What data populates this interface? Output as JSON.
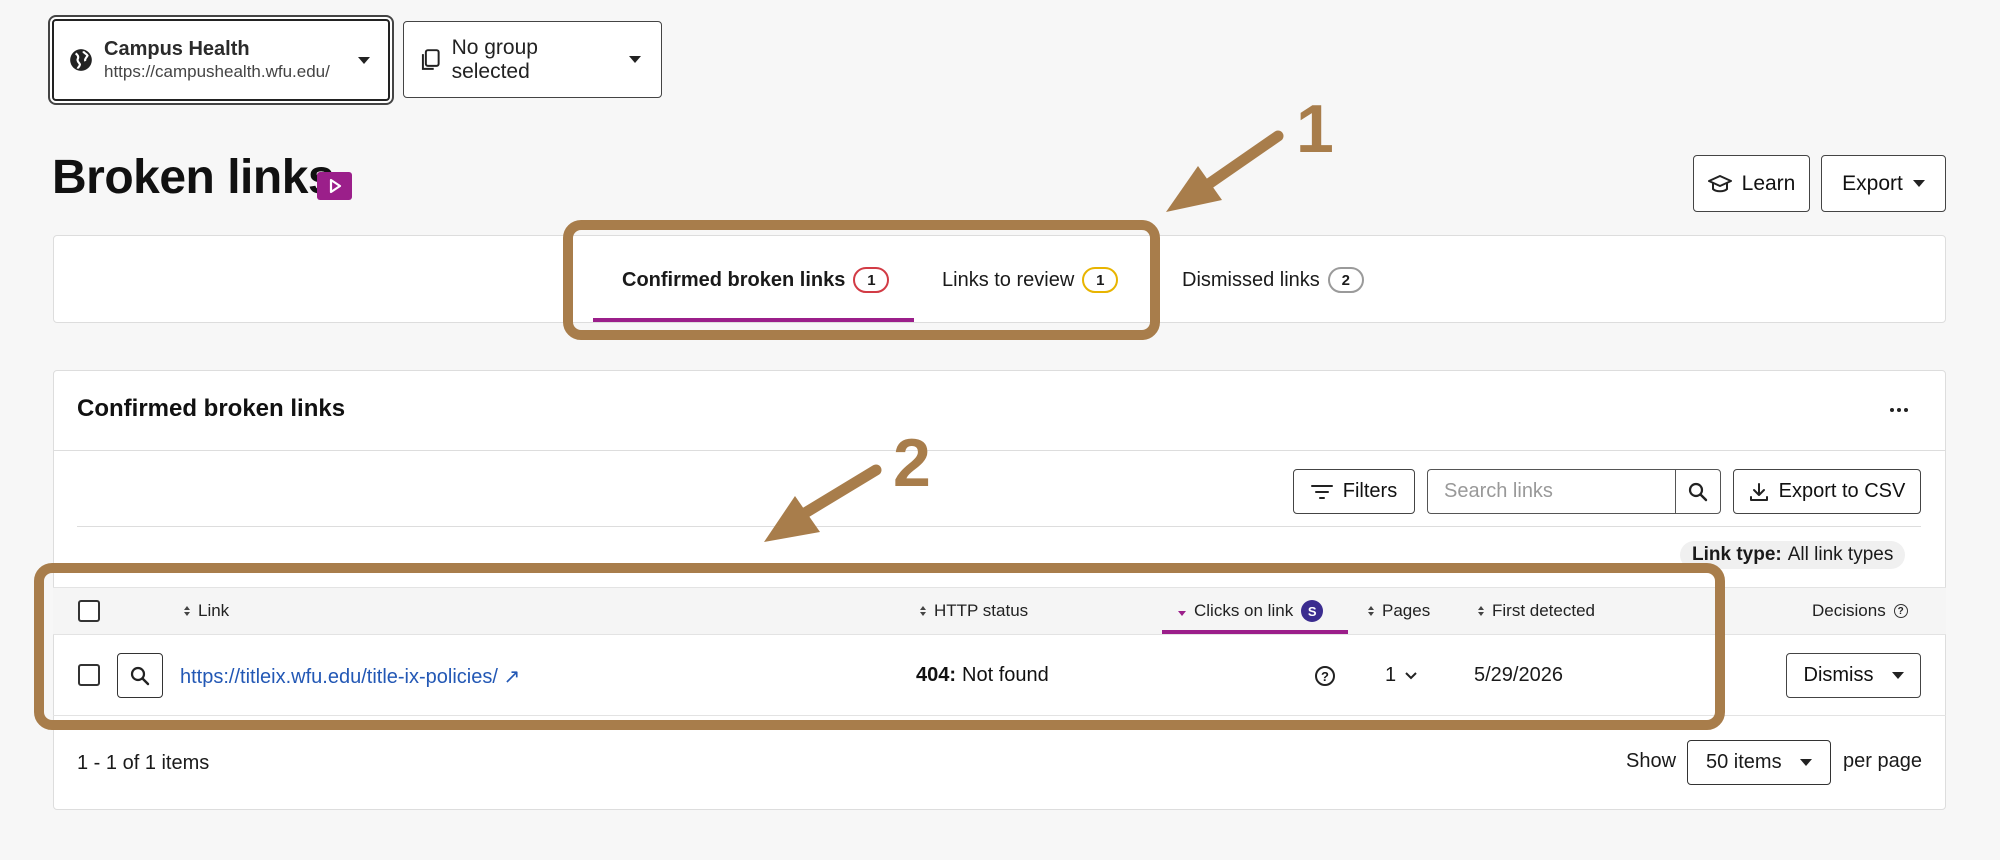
{
  "site_selector": {
    "name": "Campus Health",
    "url": "https://campushealth.wfu.edu/"
  },
  "group_selector": {
    "label": "No group selected"
  },
  "page": {
    "title": "Broken links"
  },
  "header_buttons": {
    "learn": "Learn",
    "export": "Export"
  },
  "tabs": [
    {
      "label": "Confirmed broken links",
      "count": "1",
      "active": true,
      "badge_color": "#d23b45"
    },
    {
      "label": "Links to review",
      "count": "1",
      "active": false,
      "badge_color": "#e8b400"
    },
    {
      "label": "Dismissed links",
      "count": "2",
      "active": false,
      "badge_color": "#9a9a9a"
    }
  ],
  "section": {
    "title": "Confirmed broken links"
  },
  "toolbar": {
    "filters": "Filters",
    "search_placeholder": "Search links",
    "export_csv": "Export to CSV"
  },
  "link_type": {
    "label": "Link type:",
    "value": "All link types"
  },
  "table": {
    "columns": {
      "link": "Link",
      "http_status": "HTTP status",
      "clicks": "Clicks on link",
      "clicks_badge": "S",
      "pages": "Pages",
      "first_detected": "First detected",
      "decisions": "Decisions"
    },
    "rows": [
      {
        "link": "https://titleix.wfu.edu/title-ix-policies/ ↗",
        "status_code": "404:",
        "status_text": "Not found",
        "clicks_icon": "?",
        "pages": "1",
        "first_detected": "5/29/2026",
        "decision": "Dismiss"
      }
    ]
  },
  "pagination": {
    "summary": "1 - 1 of 1 items",
    "show_label": "Show",
    "per_page_value": "50 items",
    "per_page_label": "per page"
  },
  "annotations": {
    "label_1": "1",
    "label_2": "2",
    "color": "#a87d4b"
  },
  "colors": {
    "accent": "#9b1f8a",
    "link": "#2358b5"
  }
}
